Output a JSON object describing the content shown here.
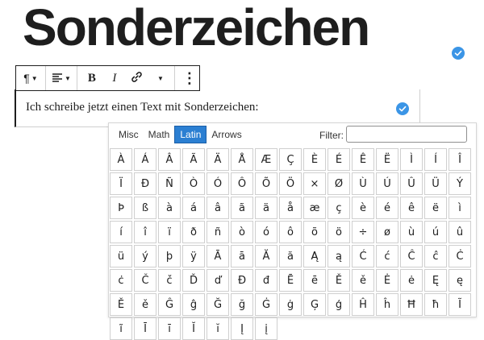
{
  "heading": "Sonderzeichen",
  "toolbar": {
    "paragraph_icon": "¶",
    "align_icon": "≡",
    "bold_label": "B",
    "italic_label": "I",
    "more_icon": "⋮"
  },
  "editor": {
    "text": "Ich schreibe jetzt einen Text mit Sonderzeichen:"
  },
  "charmap": {
    "tabs": [
      "Misc",
      "Math",
      "Latin",
      "Arrows"
    ],
    "active_tab": "Latin",
    "filter_label": "Filter:",
    "filter_value": "",
    "rows": [
      [
        "À",
        "Á",
        "Â",
        "Ã",
        "Ä",
        "Å",
        "Æ",
        "Ç",
        "È",
        "É",
        "Ê",
        "Ë",
        "Ì",
        "Í",
        "Î",
        "Ï"
      ],
      [
        "Đ",
        "Ñ",
        "Ò",
        "Ó",
        "Ô",
        "Õ",
        "Ö",
        "×",
        "Ø",
        "Ù",
        "Ú",
        "Û",
        "Ü",
        "Ý",
        "Þ",
        "ß"
      ],
      [
        "à",
        "á",
        "â",
        "ã",
        "ä",
        "å",
        "æ",
        "ç",
        "è",
        "é",
        "ê",
        "ë",
        "ì",
        "í",
        "î",
        "ï"
      ],
      [
        "ð",
        "ñ",
        "ò",
        "ó",
        "ô",
        "õ",
        "ö",
        "÷",
        "ø",
        "ù",
        "ú",
        "û",
        "ü",
        "ý",
        "þ",
        "ÿ"
      ],
      [
        "Ā",
        "ā",
        "Ă",
        "ă",
        "Ą",
        "ą",
        "Ć",
        "ć",
        "Ĉ",
        "ĉ",
        "Ċ",
        "ċ",
        "Č",
        "č",
        "Ď",
        "ď"
      ],
      [
        "Đ",
        "đ",
        "Ē",
        "ē",
        "Ě",
        "ě",
        "Ė",
        "ė",
        "Ę",
        "ę",
        "Ě",
        "ě",
        "Ĝ",
        "ĝ",
        "Ğ",
        "ğ"
      ],
      [
        "Ġ",
        "ġ",
        "Ģ",
        "ģ",
        "Ĥ",
        "ĥ",
        "Ħ",
        "ħ",
        "Ĩ",
        "ĩ",
        "Ī",
        "ī",
        "Ĭ",
        "ĭ",
        "Į",
        "į"
      ]
    ]
  },
  "colors": {
    "accent": "#2b7fd2",
    "check": "#3b95e6"
  }
}
